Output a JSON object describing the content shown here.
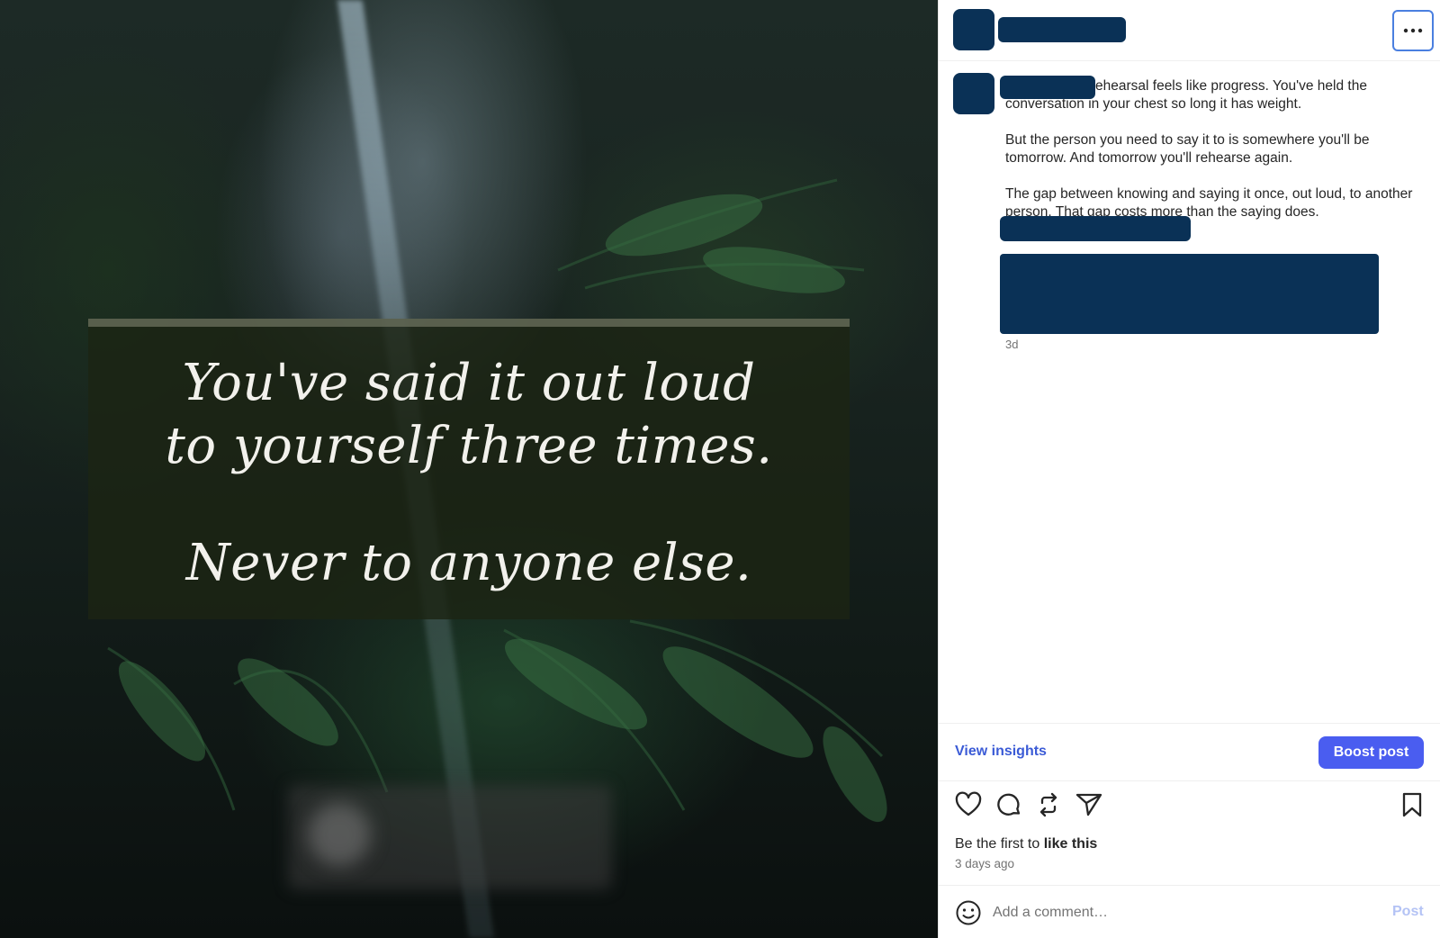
{
  "media": {
    "quote_lines_top": [
      "You've said it out loud",
      "to yourself three times."
    ],
    "quote_line_bottom": "Never to anyone else."
  },
  "header": {
    "more_icon": "more-horizontal-icon"
  },
  "caption": {
    "first_line_visible": "ehearsal feels like progress. You've held the conversation in your chest so long it has weight.",
    "paragraph_2": "But the person you need to say it to is somewhere you'll be tomorrow. And tomorrow you'll rehearse again.",
    "paragraph_3": "The gap between knowing and saying it once, out loud, to another person. That gap costs more than the saying does.",
    "timestamp": "3d"
  },
  "insights": {
    "view_insights_label": "View insights",
    "boost_label": "Boost post"
  },
  "actions": {
    "icons": [
      "heart-icon",
      "comment-icon",
      "repost-icon",
      "share-icon",
      "bookmark-icon"
    ]
  },
  "likes": {
    "prefix": "Be the first to",
    "emphasis": "like this"
  },
  "time_ago": "3 days ago",
  "comment": {
    "placeholder": "Add a comment…",
    "post_label": "Post"
  },
  "colors": {
    "redaction": "#0a3156",
    "accent_blue": "#4a5df0",
    "link_blue": "#3b5bd6",
    "post_disabled": "#b4c3f5"
  }
}
